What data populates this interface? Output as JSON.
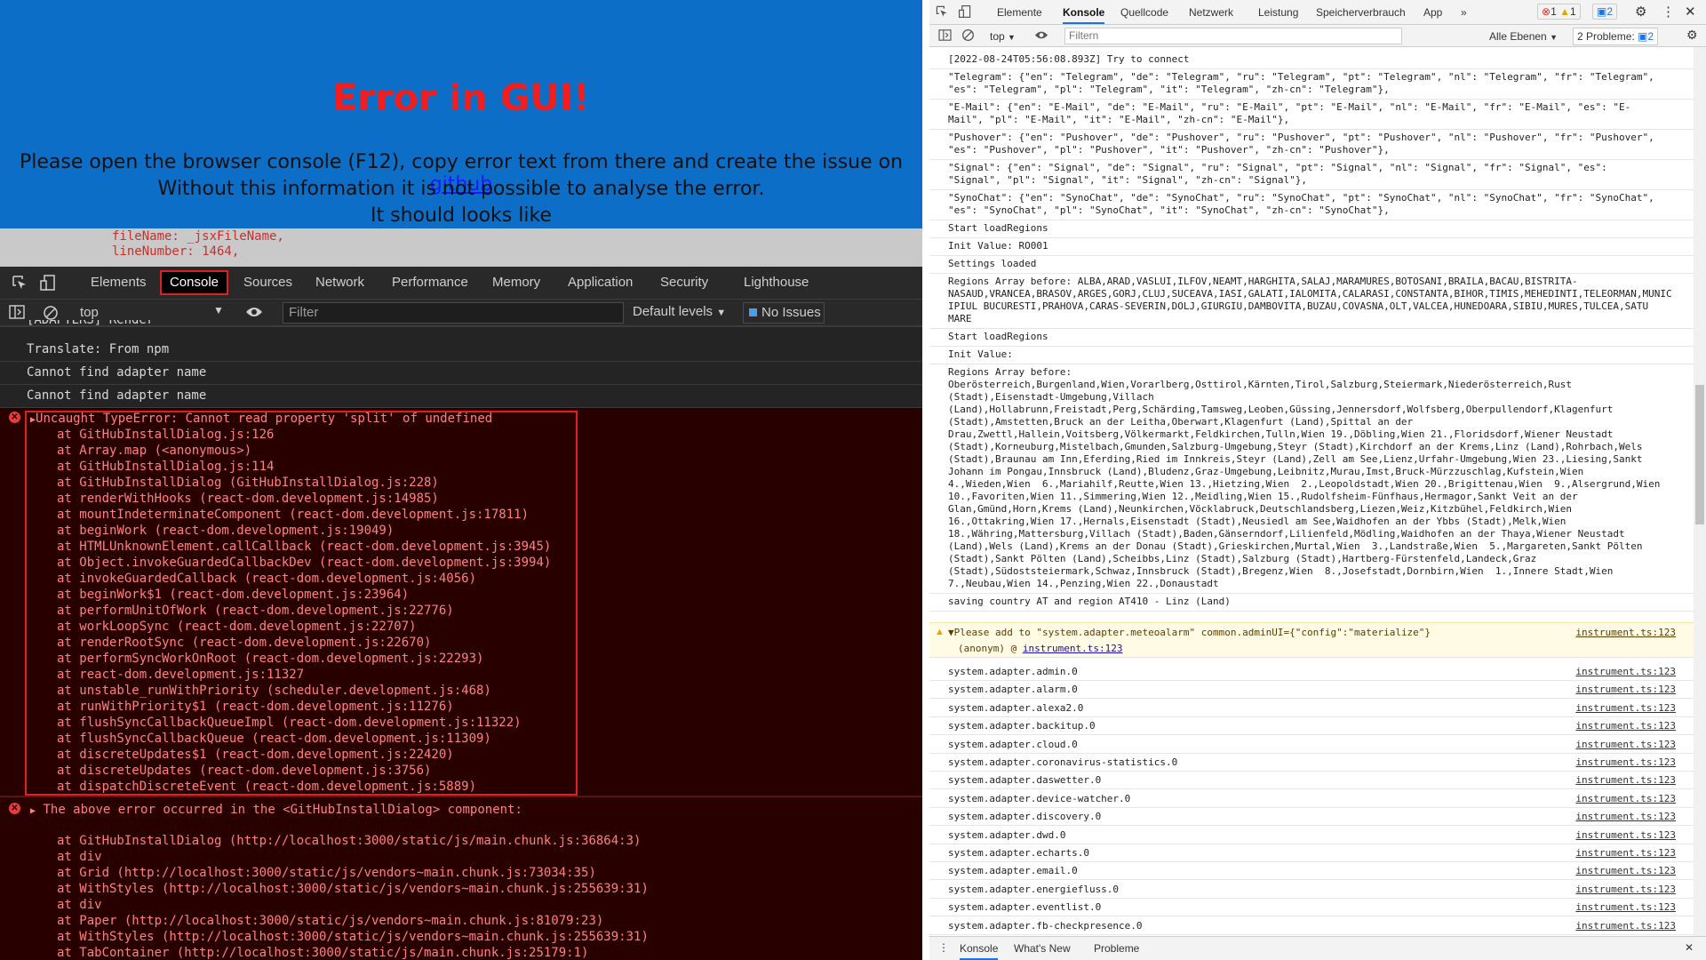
{
  "error_overlay": {
    "title": "Error in GUI!",
    "line1_prefix": "Please open the browser console (F12), copy error text from there and create the issue on ",
    "line1_link": "github",
    "line2": "Without this information it is not possible to analyse the error.",
    "line3": "It should looks like",
    "source_lines": [
      "fileName: _jsxFileName,",
      "lineNumber: 1464,"
    ]
  },
  "left_devtools": {
    "tabs": [
      "Elements",
      "Console",
      "Sources",
      "Network",
      "Performance",
      "Memory",
      "Application",
      "Security",
      "Lighthouse"
    ],
    "context": "top",
    "filter_placeholder": "Filter",
    "levels": "Default levels",
    "issues": "No Issues",
    "log_lines": [
      "[ADAPTERS] Render",
      "Translate: From npm",
      "Cannot find adapter name",
      "Cannot find adapter name"
    ],
    "error1_title": "Uncaught TypeError: Cannot read property 'split' of undefined",
    "error1_stack": [
      "at GitHubInstallDialog.js:126",
      "at Array.map (<anonymous>)",
      "at GitHubInstallDialog.js:114",
      "at GitHubInstallDialog (GitHubInstallDialog.js:228)",
      "at renderWithHooks (react-dom.development.js:14985)",
      "at mountIndeterminateComponent (react-dom.development.js:17811)",
      "at beginWork (react-dom.development.js:19049)",
      "at HTMLUnknownElement.callCallback (react-dom.development.js:3945)",
      "at Object.invokeGuardedCallbackDev (react-dom.development.js:3994)",
      "at invokeGuardedCallback (react-dom.development.js:4056)",
      "at beginWork$1 (react-dom.development.js:23964)",
      "at performUnitOfWork (react-dom.development.js:22776)",
      "at workLoopSync (react-dom.development.js:22707)",
      "at renderRootSync (react-dom.development.js:22670)",
      "at performSyncWorkOnRoot (react-dom.development.js:22293)",
      "at react-dom.development.js:11327",
      "at unstable_runWithPriority (scheduler.development.js:468)",
      "at runWithPriority$1 (react-dom.development.js:11276)",
      "at flushSyncCallbackQueueImpl (react-dom.development.js:11322)",
      "at flushSyncCallbackQueue (react-dom.development.js:11309)",
      "at discreteUpdates$1 (react-dom.development.js:22420)",
      "at discreteUpdates (react-dom.development.js:3756)",
      "at dispatchDiscreteEvent (react-dom.development.js:5889)"
    ],
    "error2_title": "The above error occurred in the <GitHubInstallDialog> component:",
    "error2_stack": [
      "at GitHubInstallDialog (http://localhost:3000/static/js/main.chunk.js:36864:3)",
      "at div",
      "at Grid (http://localhost:3000/static/js/vendors~main.chunk.js:73034:35)",
      "at WithStyles (http://localhost:3000/static/js/vendors~main.chunk.js:255639:31)",
      "at div",
      "at Paper (http://localhost:3000/static/js/vendors~main.chunk.js:81079:23)",
      "at WithStyles (http://localhost:3000/static/js/vendors~main.chunk.js:255639:31)",
      "at TabContainer (http://localhost:3000/static/js/main.chunk.js:25179:1)"
    ]
  },
  "right_devtools": {
    "tabs": [
      "Elemente",
      "Konsole",
      "Quellcode",
      "Netzwerk",
      "Leistung",
      "Speicherverbrauch",
      "App"
    ],
    "badges": {
      "errors": "1",
      "warnings": "1",
      "messages": "2"
    },
    "context": "top",
    "filter_placeholder": "Filtern",
    "levels": "Alle Ebenen",
    "problems": "2 Probleme:",
    "problems_count": "2",
    "log_lines": [
      "[2022-08-24T05:56:08.893Z] Try to connect",
      "\"Telegram\": {\"en\": \"Telegram\", \"de\": \"Telegram\", \"ru\": \"Telegram\", \"pt\": \"Telegram\", \"nl\": \"Telegram\", \"fr\": \"Telegram\",\n\"es\": \"Telegram\", \"pl\": \"Telegram\", \"it\": \"Telegram\", \"zh-cn\": \"Telegram\"},",
      "\"E-Mail\": {\"en\": \"E-Mail\", \"de\": \"E-Mail\", \"ru\": \"E-Mail\", \"pt\": \"E-Mail\", \"nl\": \"E-Mail\", \"fr\": \"E-Mail\", \"es\": \"E-\nMail\", \"pl\": \"E-Mail\", \"it\": \"E-Mail\", \"zh-cn\": \"E-Mail\"},",
      "\"Pushover\": {\"en\": \"Pushover\", \"de\": \"Pushover\", \"ru\": \"Pushover\", \"pt\": \"Pushover\", \"nl\": \"Pushover\", \"fr\": \"Pushover\",\n\"es\": \"Pushover\", \"pl\": \"Pushover\", \"it\": \"Pushover\", \"zh-cn\": \"Pushover\"},",
      "\"Signal\": {\"en\": \"Signal\", \"de\": \"Signal\", \"ru\": \"Signal\", \"pt\": \"Signal\", \"nl\": \"Signal\", \"fr\": \"Signal\", \"es\":\n\"Signal\", \"pl\": \"Signal\", \"it\": \"Signal\", \"zh-cn\": \"Signal\"},",
      "\"SynoChat\": {\"en\": \"SynoChat\", \"de\": \"SynoChat\", \"ru\": \"SynoChat\", \"pt\": \"SynoChat\", \"nl\": \"SynoChat\", \"fr\": \"SynoChat\",\n\"es\": \"SynoChat\", \"pl\": \"SynoChat\", \"it\": \"SynoChat\", \"zh-cn\": \"SynoChat\"},",
      "Start loadRegions",
      "Init Value: RO001",
      "Settings loaded",
      "Regions Array before: ALBA,ARAD,VASLUI,ILFOV,NEAMT,HARGHITA,SALAJ,MARAMURES,BOTOSANI,BRAILA,BACAU,BISTRITA-\nNASAUD,VRANCEA,BRASOV,ARGES,GORJ,CLUJ,SUCEAVA,IASI,GALATI,IALOMITA,CALARASI,CONSTANTA,BIHOR,TIMIS,MEHEDINTI,TELEORMAN,MUNIC\nIPIUL BUCURESTI,PRAHOVA,CARAS-SEVERIN,DOLJ,GIURGIU,DAMBOVITA,BUZAU,COVASNA,OLT,VALCEA,HUNEDOARA,SIBIU,MURES,TULCEA,SATU\nMARE",
      "Start loadRegions",
      "Init Value:",
      "Regions Array before:\nOberösterreich,Burgenland,Wien,Vorarlberg,Osttirol,Kärnten,Tirol,Salzburg,Steiermark,Niederösterreich,Rust\n(Stadt),Eisenstadt-Umgebung,Villach\n(Land),Hollabrunn,Freistadt,Perg,Schärding,Tamsweg,Leoben,Güssing,Jennersdorf,Wolfsberg,Oberpullendorf,Klagenfurt\n(Stadt),Amstetten,Bruck an der Leitha,Oberwart,Klagenfurt (Land),Spittal an der\nDrau,Zwettl,Hallein,Voitsberg,Völkermarkt,Feldkirchen,Tulln,Wien 19.,Döbling,Wien 21.,Floridsdorf,Wiener Neustadt\n(Stadt),Korneuburg,Mistelbach,Gmunden,Salzburg-Umgebung,Steyr (Stadt),Kirchdorf an der Krems,Linz (Land),Rohrbach,Wels\n(Stadt),Braunau am Inn,Eferding,Ried im Innkreis,Steyr (Land),Zell am See,Lienz,Urfahr-Umgebung,Wien 23.,Liesing,Sankt\nJohann im Pongau,Innsbruck (Land),Bludenz,Graz-Umgebung,Leibnitz,Murau,Imst,Bruck-Mürzzuschlag,Kufstein,Wien\n4.,Wieden,Wien  6.,Mariahilf,Reutte,Wien 13.,Hietzing,Wien  2.,Leopoldstadt,Wien 20.,Brigittenau,Wien  9.,Alsergrund,Wien\n10.,Favoriten,Wien 11.,Simmering,Wien 12.,Meidling,Wien 15.,Rudolfsheim-Fünfhaus,Hermagor,Sankt Veit an der\nGlan,Gmünd,Horn,Krems (Land),Neunkirchen,Vöcklabruck,Deutschlandsberg,Liezen,Weiz,Kitzbühel,Feldkirch,Wien\n16.,Ottakring,Wien 17.,Hernals,Eisenstadt (Stadt),Neusiedl am See,Waidhofen an der Ybbs (Stadt),Melk,Wien\n18.,Währing,Mattersburg,Villach (Stadt),Baden,Gänserndorf,Lilienfeld,Mödling,Waidhofen an der Thaya,Wiener Neustadt\n(Land),Wels (Land),Krems an der Donau (Stadt),Grieskirchen,Murtal,Wien  3.,Landstraße,Wien  5.,Margareten,Sankt Pölten\n(Stadt),Sankt Pölten (Land),Scheibbs,Linz (Stadt),Salzburg (Stadt),Hartberg-Fürstenfeld,Landeck,Graz\n(Stadt),Südoststeiermark,Schwaz,Innsbruck (Stadt),Bregenz,Wien  8.,Josefstadt,Dornbirn,Wien  1.,Innere Stadt,Wien\n7.,Neubau,Wien 14.,Penzing,Wien 22.,Donaustadt",
      "saving country AT and region AT410 - Linz (Land)"
    ],
    "warning_text": "Please add to \"system.adapter.meteoalarm\" common.adminUI={\"config\":\"materialize\"}",
    "warning_sub": "(anonym) @",
    "warning_link": "instrument.ts:123",
    "adapter_lines": [
      "system.adapter.admin.0",
      "system.adapter.alarm.0",
      "system.adapter.alexa2.0",
      "system.adapter.backitup.0",
      "system.adapter.cloud.0",
      "system.adapter.coronavirus-statistics.0",
      "system.adapter.daswetter.0",
      "system.adapter.device-watcher.0",
      "system.adapter.discovery.0",
      "system.adapter.dwd.0",
      "system.adapter.echarts.0",
      "system.adapter.email.0",
      "system.adapter.energiefluss.0",
      "system.adapter.eventlist.0",
      "system.adapter.fb-checkpresence.0"
    ],
    "source_link": "instrument.ts:123",
    "bottom_tabs": [
      "Konsole",
      "What's New",
      "Probleme"
    ]
  }
}
